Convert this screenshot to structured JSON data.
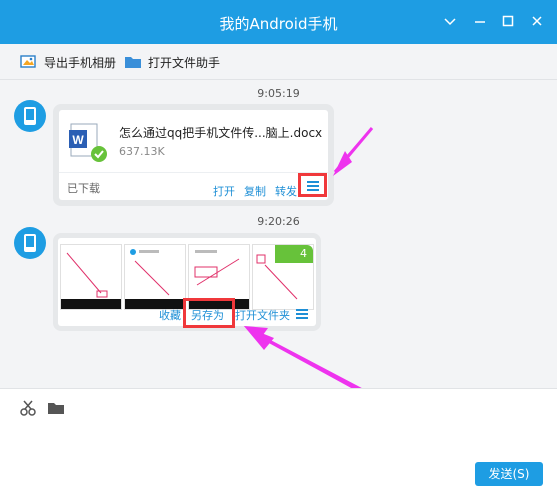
{
  "window": {
    "title": "我的Android手机",
    "controls": {
      "restore_icon": "restore-icon",
      "minimize_icon": "minimize-icon",
      "maximize_icon": "maximize-icon",
      "close_icon": "close-icon"
    }
  },
  "toolbar": {
    "export_album": "导出手机相册",
    "open_file_assistant": "打开文件助手"
  },
  "messages": [
    {
      "time": "9:05:19",
      "file_name": "怎么通过qq把手机文件传...脑上.docx",
      "file_size": "637.13K",
      "status": "已下载",
      "actions": [
        "打开",
        "复制",
        "转发"
      ],
      "file_type_icon": "word-icon"
    },
    {
      "time": "9:20:26",
      "image_count": "4",
      "actions": [
        "收藏",
        "另存为",
        "打开文件夹"
      ]
    }
  ],
  "input": {
    "send_label": "发送(S)",
    "tools": [
      "scissors-icon",
      "folder-icon"
    ]
  },
  "colors": {
    "brand": "#1e9de3",
    "highlight": "#f0383b",
    "annotation": "#ee33ee",
    "link": "#1e8fd6"
  }
}
